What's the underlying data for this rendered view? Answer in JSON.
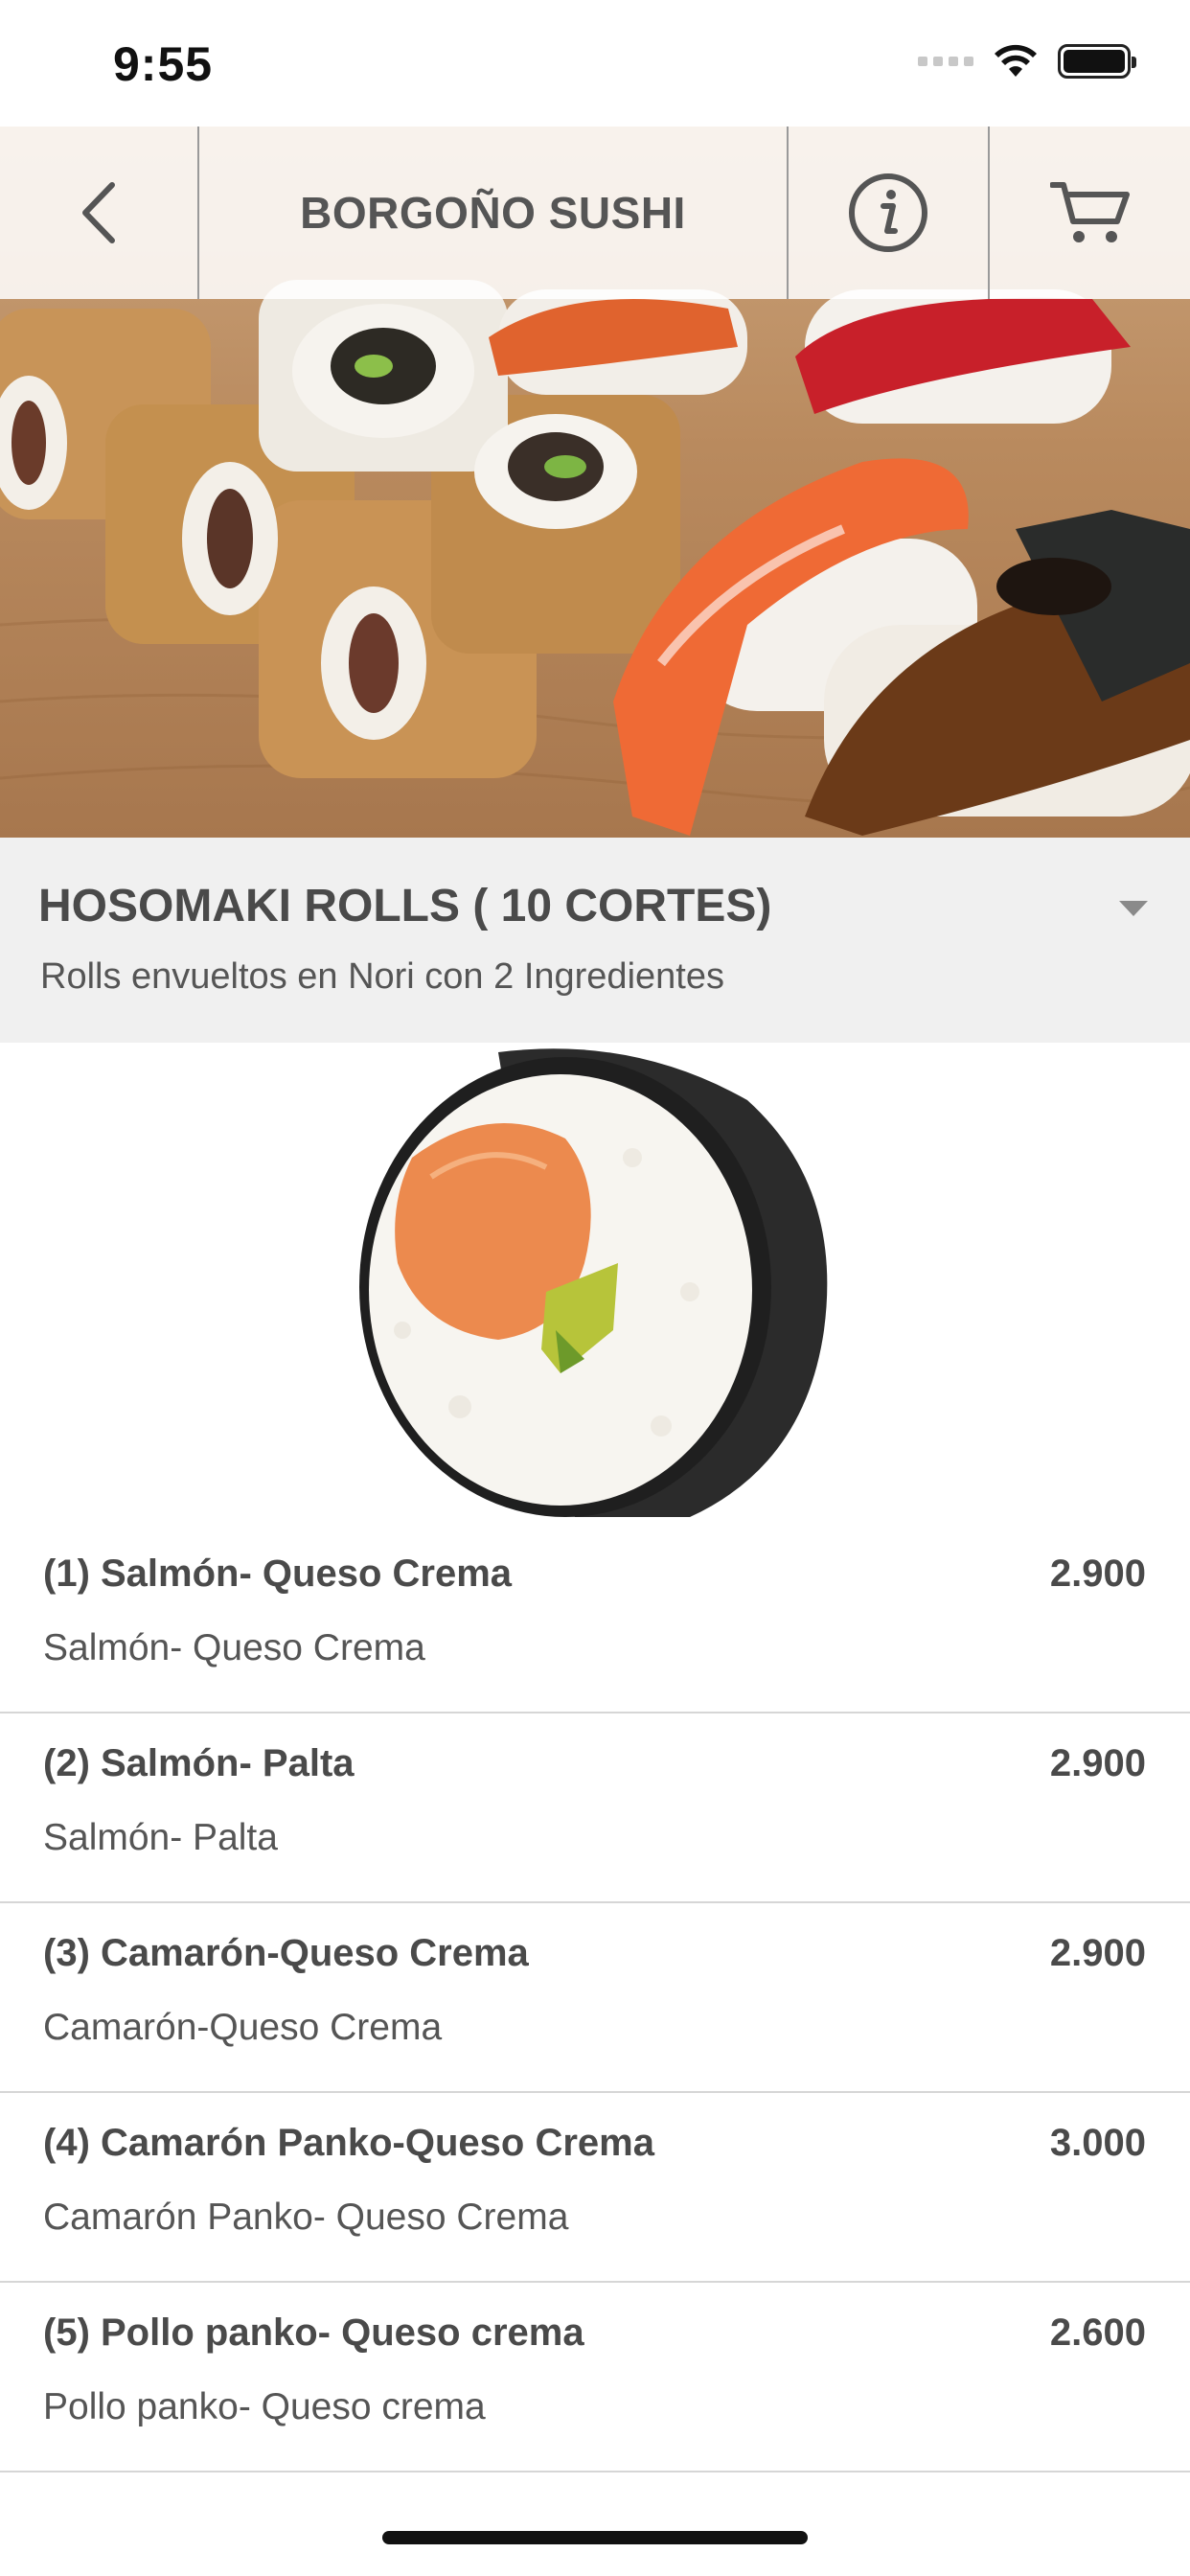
{
  "status_bar": {
    "time": "9:55",
    "icons": [
      "cellular-signal-icon",
      "wifi-icon",
      "battery-icon"
    ]
  },
  "nav": {
    "back_icon": "chevron-left-icon",
    "title": "BORGOÑO SUSHI",
    "info_icon": "info-icon",
    "cart_icon": "cart-icon"
  },
  "category": {
    "title": "HOSOMAKI ROLLS ( 10 CORTES)",
    "subtitle": "Rolls envueltos en Nori con 2 Ingredientes",
    "caret_icon": "caret-down-icon"
  },
  "items": [
    {
      "name": "(1) Salmón- Queso Crema",
      "price": "2.900",
      "description": "Salmón- Queso Crema"
    },
    {
      "name": "(2) Salmón- Palta",
      "price": "2.900",
      "description": "Salmón- Palta"
    },
    {
      "name": "(3) Camarón-Queso Crema",
      "price": "2.900",
      "description": "Camarón-Queso Crema"
    },
    {
      "name": "(4) Camarón Panko-Queso Crema",
      "price": "3.000",
      "description": "Camarón Panko- Queso Crema"
    },
    {
      "name": "(5) Pollo panko- Queso crema",
      "price": "2.600",
      "description": "Pollo panko- Queso crema"
    }
  ],
  "colors": {
    "text": "#4a4a4a",
    "category_bg": "#f0f0f0",
    "divider": "#d6d6d6"
  }
}
